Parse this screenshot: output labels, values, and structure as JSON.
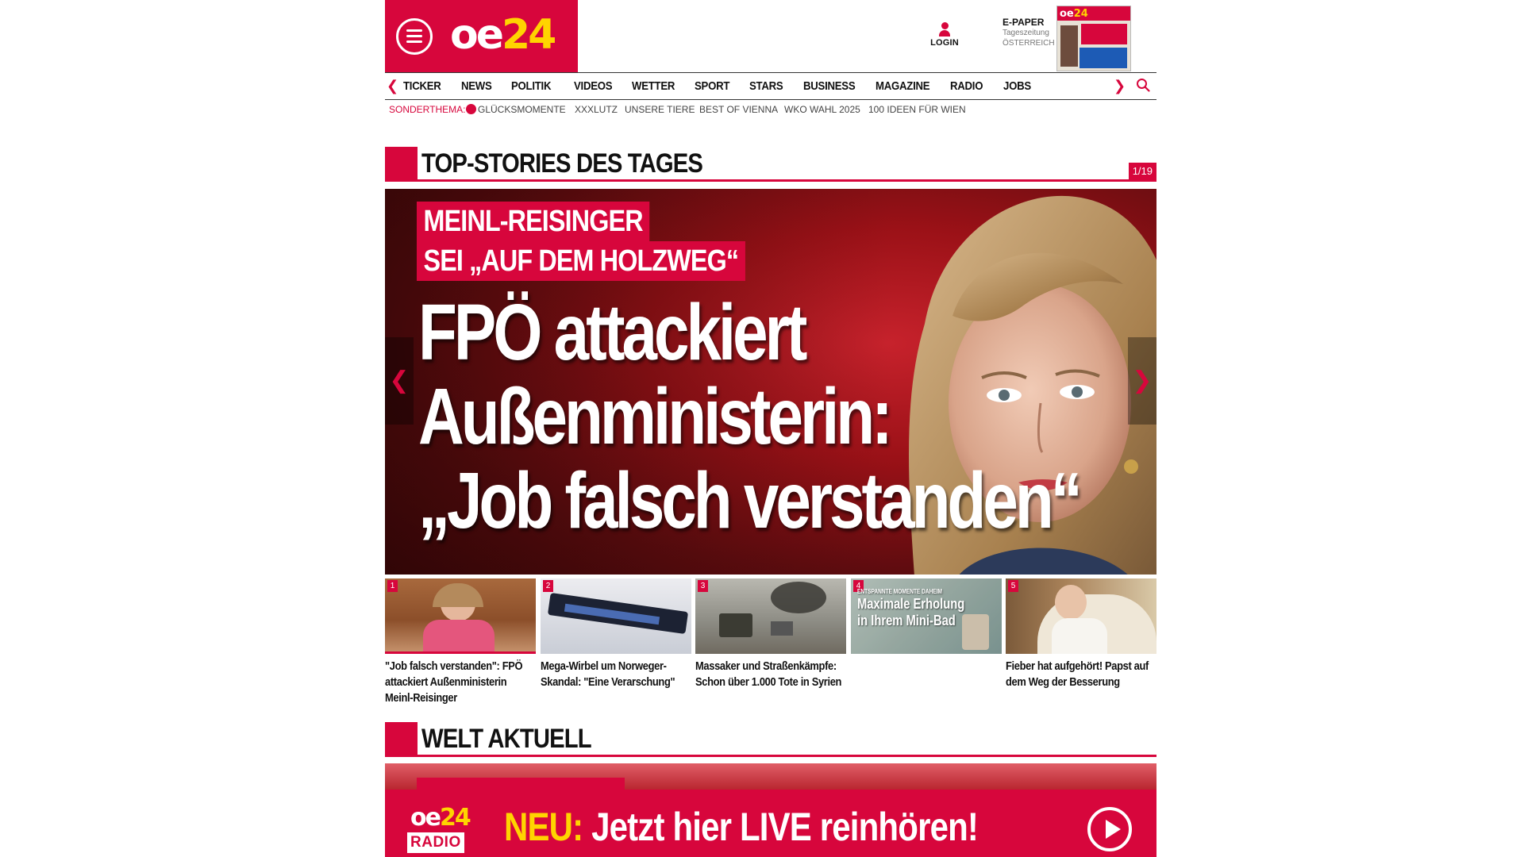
{
  "header": {
    "logo_text": "oe",
    "logo_num": "24",
    "login_label": "LOGIN",
    "epaper_title": "E-PAPER",
    "epaper_sub1": "Tageszeitung",
    "epaper_sub2": "ÖSTERREICH"
  },
  "nav": {
    "items": [
      "TICKER",
      "NEWS",
      "POLITIK",
      "VIDEOS",
      "WETTER",
      "SPORT",
      "STARS",
      "BUSINESS",
      "MAGAZINE",
      "RADIO",
      "JOBS"
    ],
    "prev_icon": "chevron-left-icon",
    "next_icon": "chevron-right-icon",
    "search_icon": "search-icon"
  },
  "subnav": {
    "lead": "SONDERTHEMA:",
    "items": [
      "GLÜCKSMOMENTE",
      "XXXLUTZ",
      "UNSERE TIERE",
      "BEST OF VIENNA",
      "WKO WAHL 2025",
      "100 IDEEN FÜR WIEN"
    ]
  },
  "top_stories": {
    "title": "TOP-STORIES DES TAGES",
    "counter": "1/19",
    "hero": {
      "kicker_line1": "MEINL-REISINGER",
      "kicker_line2": "SEI „AUF DEM HOLZWEG“",
      "headline_line1": "FPÖ attackiert",
      "headline_line2": "Außenministerin:",
      "headline_line3": "„Job falsch verstanden“"
    },
    "thumbs": [
      {
        "num": "1",
        "caption": "\"Job falsch verstanden\": FPÖ attackiert Außenministerin Meinl-Reisinger"
      },
      {
        "num": "2",
        "caption": "Mega-Wirbel um Norweger-Skandal: \"Eine Verarschung\""
      },
      {
        "num": "3",
        "caption": "Massaker und Straßenkämpfe: Schon über 1.000 Tote in Syrien"
      },
      {
        "num": "4",
        "caption": "",
        "overlay_small": "ENTSPANNTE MOMENTE DAHEIM",
        "overlay": "Maximale Erholung in Ihrem Mini-Bad"
      },
      {
        "num": "5",
        "caption": "Fieber hat aufgehört! Papst auf dem Weg der Besserung"
      }
    ]
  },
  "welt": {
    "title": "WELT AKTUELL"
  },
  "radio_banner": {
    "logo_oe": "oe",
    "logo_num": "24",
    "logo_radio": "RADIO",
    "neu": "NEU:",
    "text": " Jetzt hier LIVE reinhören!"
  },
  "colors": {
    "brand_red": "#d7063c",
    "accent_yellow": "#ffd400"
  }
}
